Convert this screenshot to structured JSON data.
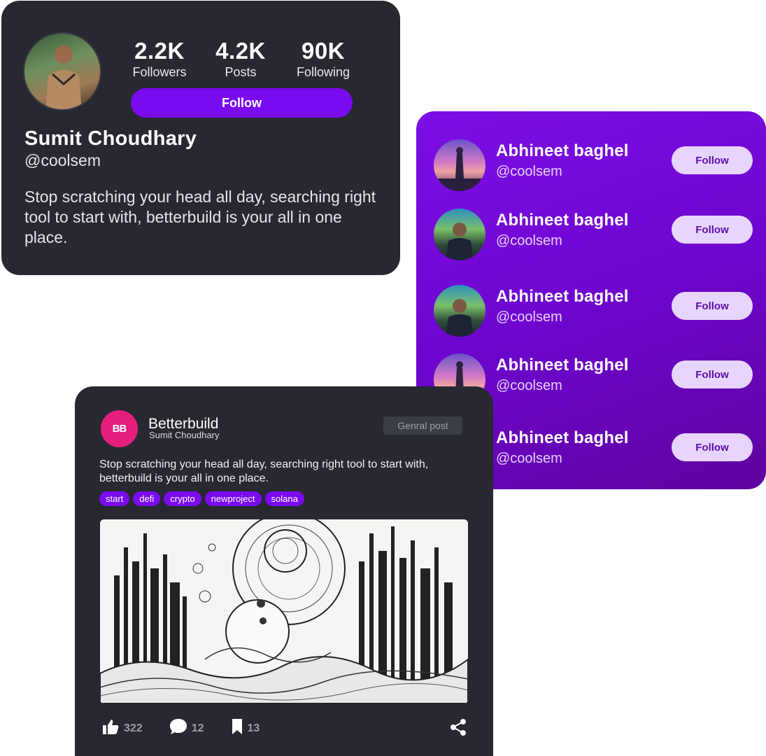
{
  "profile": {
    "stats": [
      {
        "value": "2.2K",
        "label": "Followers"
      },
      {
        "value": "4.2K",
        "label": "Posts"
      },
      {
        "value": "90K",
        "label": "Following"
      }
    ],
    "follow_label": "Follow",
    "name": "Sumit Choudhary",
    "handle": "@coolsem",
    "bio": "Stop scratching your head all day, searching right tool to start with, betterbuild is your all in one place."
  },
  "suggestions": [
    {
      "name": "Abhineet baghel",
      "handle": "@coolsem",
      "follow_label": "Follow",
      "avatar": "hero"
    },
    {
      "name": "Abhineet baghel",
      "handle": "@coolsem",
      "follow_label": "Follow",
      "avatar": "man"
    },
    {
      "name": "Abhineet baghel",
      "handle": "@coolsem",
      "follow_label": "Follow",
      "avatar": "man"
    },
    {
      "name": "Abhineet baghel",
      "handle": "@coolsem",
      "follow_label": "Follow",
      "avatar": "hero"
    },
    {
      "name": "Abhineet baghel",
      "handle": "@coolsem",
      "follow_label": "Follow",
      "avatar": "none"
    }
  ],
  "post": {
    "logo_text": "BB",
    "brand": "Betterbuild",
    "author": "Sumit Choudhary",
    "type_label": "Genral post",
    "text": "Stop scratching your head all day, searching right tool to start with, betterbuild is your all in one place.",
    "tags": [
      "start",
      "defi",
      "crypto",
      "newproject",
      "solana"
    ],
    "likes": "322",
    "comments": "12",
    "bookmarks": "13"
  },
  "colors": {
    "card_dark": "#272830",
    "accent_purple": "#7a0af0",
    "logo_pink": "#e51e7c",
    "follow_pill_light": "#e8d5ff"
  }
}
